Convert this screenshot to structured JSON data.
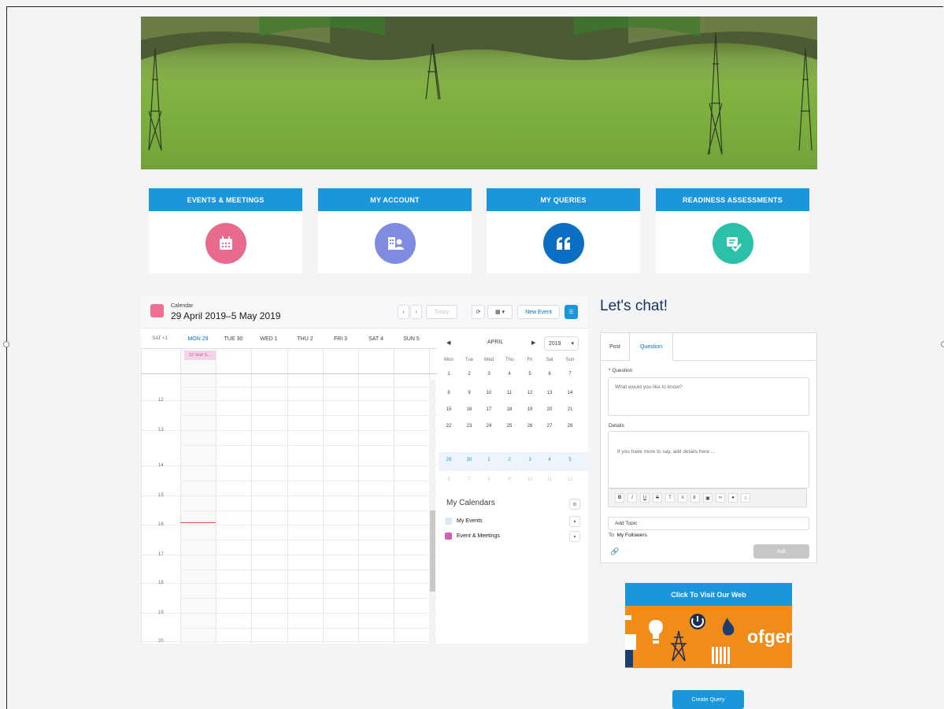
{
  "tiles": [
    {
      "label": "EVENTS & MEETINGS",
      "icon": "calendar-icon",
      "color": "#e86a8c"
    },
    {
      "label": "MY ACCOUNT",
      "icon": "account-icon",
      "color": "#7f8ce0"
    },
    {
      "label": "MY QUERIES",
      "icon": "quote-icon",
      "color": "#0b6fc4"
    },
    {
      "label": "READINESS ASSESSMENTS",
      "icon": "checklist-icon",
      "color": "#2bc0a8"
    }
  ],
  "calendar": {
    "kicker": "Calendar",
    "range": "29 April 2019–5 May 2019",
    "today_label": "Today",
    "new_event_label": "New Event",
    "days": [
      "SAT +1",
      "MON 29",
      "TUE 30",
      "WED 1",
      "THU 2",
      "FRI 3",
      "SAT 4",
      "SUN 5"
    ],
    "all_day_event": "12 Visit S...",
    "hours": [
      "12",
      "13",
      "14",
      "15",
      "16",
      "17",
      "18",
      "19",
      "20"
    ]
  },
  "mini_calendar": {
    "month": "APRIL",
    "year": "2019",
    "weekdays": [
      "Mon",
      "Tue",
      "Wed",
      "Thu",
      "Fri",
      "Sat",
      "Sun"
    ],
    "weeks": [
      [
        "1",
        "2",
        "3",
        "4",
        "5",
        "6",
        "7"
      ],
      [
        "8",
        "9",
        "10",
        "11",
        "12",
        "13",
        "14"
      ],
      [
        "15",
        "16",
        "17",
        "18",
        "19",
        "20",
        "21"
      ],
      [
        "22",
        "23",
        "24",
        "25",
        "26",
        "27",
        "28"
      ],
      [
        "29",
        "30",
        "1",
        "2",
        "3",
        "4",
        "5"
      ],
      [
        "6",
        "7",
        "8",
        "9",
        "10",
        "11",
        "12"
      ]
    ],
    "my_calendars_title": "My Calendars",
    "calendars": [
      {
        "label": "My Events",
        "color": "#d8e9f8"
      },
      {
        "label": "Event & Meetings",
        "color": "#d85bb5"
      }
    ]
  },
  "chat": {
    "title": "Let's chat!",
    "tabs": [
      "Post",
      "Question"
    ],
    "question_label": "* Question",
    "question_placeholder": "What would you like to know?",
    "details_label": "Details",
    "details_placeholder": "If you have more to say, add details here ...",
    "add_topic_placeholder": "Add Topic",
    "to_label": "To",
    "to_value": "My Followers",
    "ask_label": "Ask"
  },
  "web_banner": {
    "title": "Click To Visit Our Web",
    "brand_text": "ofger"
  },
  "create_query_label": "Create Query"
}
